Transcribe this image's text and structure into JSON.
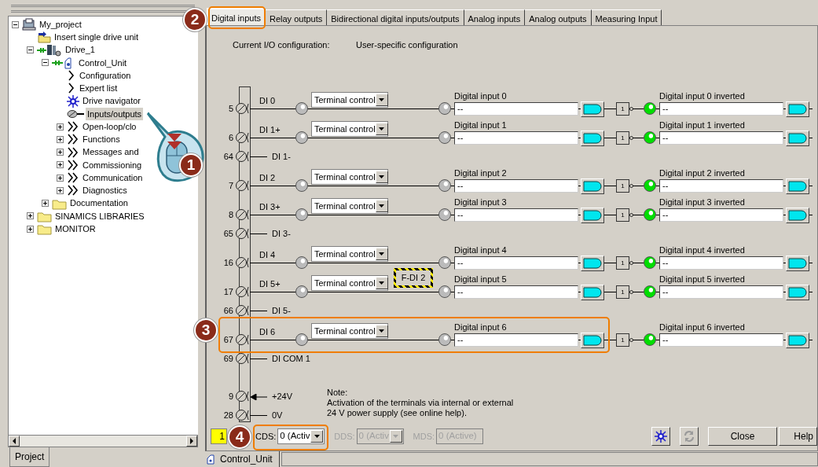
{
  "project_panel": {
    "tree": [
      {
        "label": "My_project",
        "kind": "project",
        "expanded": true,
        "selected": false,
        "children": [
          {
            "label": "Insert single drive unit",
            "kind": "insert",
            "selected": false
          },
          {
            "label": "Drive_1",
            "kind": "drive",
            "expanded": true,
            "selected": false,
            "children": [
              {
                "label": "Control_Unit",
                "kind": "unit",
                "expanded": true,
                "selected": false,
                "children": [
                  {
                    "label": "Configuration",
                    "kind": "single",
                    "selected": false
                  },
                  {
                    "label": "Expert list",
                    "kind": "single",
                    "selected": false
                  },
                  {
                    "label": "Drive navigator",
                    "kind": "navigator",
                    "selected": false
                  },
                  {
                    "label": "Inputs/outputs",
                    "kind": "io",
                    "selected": true
                  },
                  {
                    "label": "Open-loop/clo",
                    "kind": "group",
                    "expanded": false,
                    "selected": false
                  },
                  {
                    "label": "Functions",
                    "kind": "group",
                    "expanded": false,
                    "selected": false
                  },
                  {
                    "label": "Messages and",
                    "kind": "group",
                    "expanded": false,
                    "selected": false
                  },
                  {
                    "label": "Commissioning",
                    "kind": "group",
                    "expanded": false,
                    "selected": false
                  },
                  {
                    "label": "Communication",
                    "kind": "group",
                    "expanded": false,
                    "selected": false
                  },
                  {
                    "label": "Diagnostics",
                    "kind": "group",
                    "expanded": false,
                    "selected": false
                  }
                ]
              },
              {
                "label": "Documentation",
                "kind": "folder",
                "expanded": false,
                "selected": false
              }
            ]
          },
          {
            "label": "SINAMICS LIBRARIES",
            "kind": "folder",
            "expanded": false,
            "selected": false
          },
          {
            "label": "MONITOR",
            "kind": "folder",
            "expanded": false,
            "selected": false
          }
        ]
      }
    ],
    "tab": "Project"
  },
  "tabs": [
    {
      "label": "Digital inputs",
      "selected": true
    },
    {
      "label": "Relay outputs",
      "selected": false
    },
    {
      "label": "Bidirectional digital inputs/outputs",
      "selected": false
    },
    {
      "label": "Analog inputs",
      "selected": false
    },
    {
      "label": "Analog outputs",
      "selected": false
    },
    {
      "label": "Measuring Input",
      "selected": false
    }
  ],
  "io_config": {
    "label": "Current I/O configuration:",
    "value": "User-specific configuration"
  },
  "terminals": [
    {
      "kind": "input",
      "number": "5",
      "label": "DI 0",
      "source": "Terminal control",
      "signal": "Digital input 0",
      "value": "--",
      "state": false,
      "gate": "1",
      "inverted_signal": "Digital input 0 inverted",
      "inverted_value": "--",
      "inverted_state": true
    },
    {
      "kind": "input",
      "number": "6",
      "label": "DI 1+",
      "source": "Terminal control",
      "signal": "Digital input 1",
      "value": "--",
      "state": false,
      "gate": "1",
      "inverted_signal": "Digital input 1 inverted",
      "inverted_value": "--",
      "inverted_state": true
    },
    {
      "kind": "return",
      "number": "64",
      "label": "DI 1-"
    },
    {
      "kind": "input",
      "number": "7",
      "label": "DI 2",
      "source": "Terminal control",
      "signal": "Digital input 2",
      "value": "--",
      "state": false,
      "gate": "1",
      "inverted_signal": "Digital input 2 inverted",
      "inverted_value": "--",
      "inverted_state": true
    },
    {
      "kind": "input",
      "number": "8",
      "label": "DI 3+",
      "source": "Terminal control",
      "signal": "Digital input 3",
      "value": "--",
      "state": false,
      "gate": "1",
      "inverted_signal": "Digital input 3 inverted",
      "inverted_value": "--",
      "inverted_state": true
    },
    {
      "kind": "return",
      "number": "65",
      "label": "DI 3-"
    },
    {
      "kind": "input",
      "number": "16",
      "label": "DI 4",
      "source": "Terminal control",
      "signal": "Digital input 4",
      "value": "--",
      "state": false,
      "gate": "1",
      "inverted_signal": "Digital input 4 inverted",
      "inverted_value": "--",
      "inverted_state": true
    },
    {
      "kind": "input",
      "number": "17",
      "label": "DI 5+",
      "source": "Terminal control",
      "signal": "Digital input 5",
      "value": "--",
      "state": false,
      "gate": "1",
      "inverted_signal": "Digital input 5 inverted",
      "inverted_value": "--",
      "inverted_state": true
    },
    {
      "kind": "return",
      "number": "66",
      "label": "DI 5-"
    },
    {
      "kind": "input",
      "number": "67",
      "label": "DI 6",
      "source": "Terminal control",
      "signal": "Digital input 6",
      "value": "--",
      "state": false,
      "gate": "1",
      "inverted_signal": "Digital input 6 inverted",
      "inverted_value": "--",
      "inverted_state": true
    },
    {
      "kind": "return",
      "number": "69",
      "label": "DI COM 1"
    },
    {
      "kind": "supply",
      "number": "9",
      "label": "+24V"
    },
    {
      "kind": "return",
      "number": "28",
      "label": "0V"
    }
  ],
  "safety_tag": "F-DI 2",
  "note": [
    "Note:",
    "Activation of the terminals via internal or external",
    "24 V power supply (see online help)."
  ],
  "footer": {
    "indicator": "1",
    "selectors": [
      {
        "label": "CDS:",
        "value": "0 (Activ",
        "kind": "dropdown",
        "disabled": false
      },
      {
        "label": "DDS:",
        "value": "0 (Activ",
        "kind": "dropdown",
        "disabled": true
      },
      {
        "label": "MDS:",
        "value": "0 (Active)",
        "kind": "field",
        "disabled": true
      }
    ],
    "buttons": [
      {
        "kind": "gear",
        "disabled": false
      },
      {
        "kind": "refresh",
        "disabled": true
      },
      {
        "kind": "text",
        "label": "Close",
        "disabled": false
      },
      {
        "kind": "text",
        "label": "Help",
        "disabled": false
      }
    ]
  },
  "document_tab": "Control_Unit",
  "callouts": [
    "1",
    "2",
    "3",
    "4"
  ]
}
